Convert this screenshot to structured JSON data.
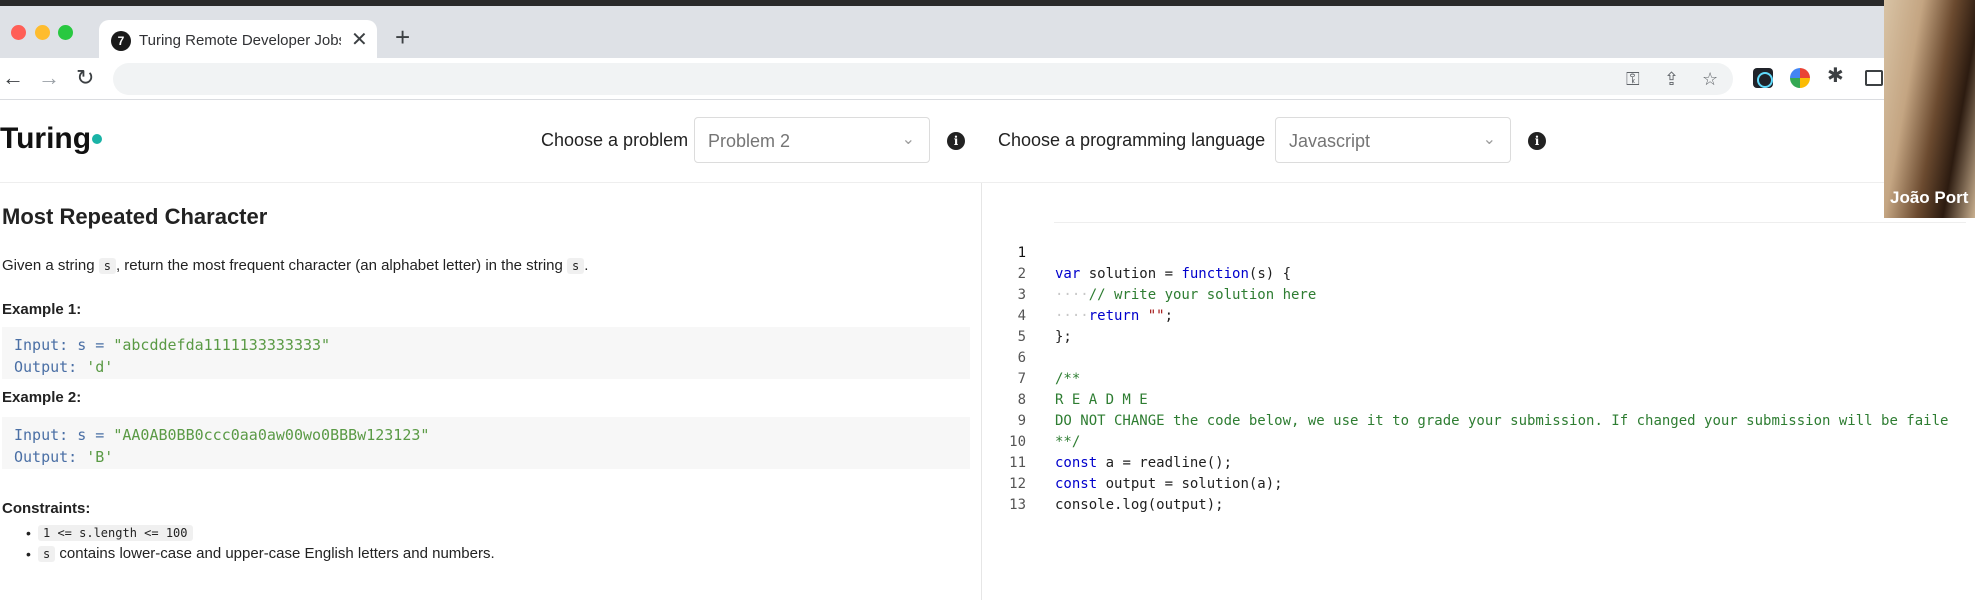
{
  "browser": {
    "tab_title": "Turing Remote Developer Jobs",
    "tab_favicon_glyph": "7",
    "tab_close": "✕",
    "new_tab": "+",
    "url": ""
  },
  "webcam": {
    "participant_name": "João Port"
  },
  "header": {
    "logo_text": "Turing",
    "logo_dot_color": "#1ab3a6",
    "problem_label": "Choose a problem",
    "problem_value": "Problem 2",
    "language_label": "Choose a programming language",
    "language_value": "Javascript"
  },
  "problem": {
    "title": "Most Repeated Character",
    "desc_before": "Given a string ",
    "desc_code_1": "s",
    "desc_middle": ", return the most frequent character (an alphabet letter) in the string ",
    "desc_code_2": "s",
    "desc_after": ".",
    "examples": [
      {
        "title": "Example 1:",
        "input_key": "Input: s = ",
        "input_val": "\"abcddefda1111133333333\"",
        "output_key": "Output: ",
        "output_val": "'d'"
      },
      {
        "title": "Example 2:",
        "input_key": "Input: s = ",
        "input_val": "\"AA0AB0BB0ccc0aa0aw00wo0BBBw123123\"",
        "output_key": "Output: ",
        "output_val": "'B'"
      }
    ],
    "constraints_title": "Constraints:",
    "constraints": [
      {
        "code": "1 <= s.length <= 100",
        "text": ""
      },
      {
        "code": "s",
        "text": " contains lower-case and upper-case English letters and numbers."
      }
    ]
  },
  "editor": {
    "line_numbers": [
      "1",
      "2",
      "3",
      "4",
      "5",
      "6",
      "7",
      "8",
      "9",
      "10",
      "11",
      "12",
      "13"
    ],
    "lines": {
      "l1_kw1": "var",
      "l1_a": " solution = ",
      "l1_kw2": "function",
      "l1_b": "(s) {",
      "l2_comment": "// write your solution here",
      "l3_kw": "return",
      "l3_str": "\"\"",
      "l3_end": ";",
      "l4": "};",
      "l6": "/**",
      "l7": "R E A D M E",
      "l8": "DO NOT CHANGE the code below, we use it to grade your submission. If changed your submission will be faile",
      "l9": "**/",
      "l10_kw": "const",
      "l10_rest": " a = readline();",
      "l11_kw": "const",
      "l11_rest": " output = solution(a);",
      "l12": "console.log(output);"
    }
  }
}
